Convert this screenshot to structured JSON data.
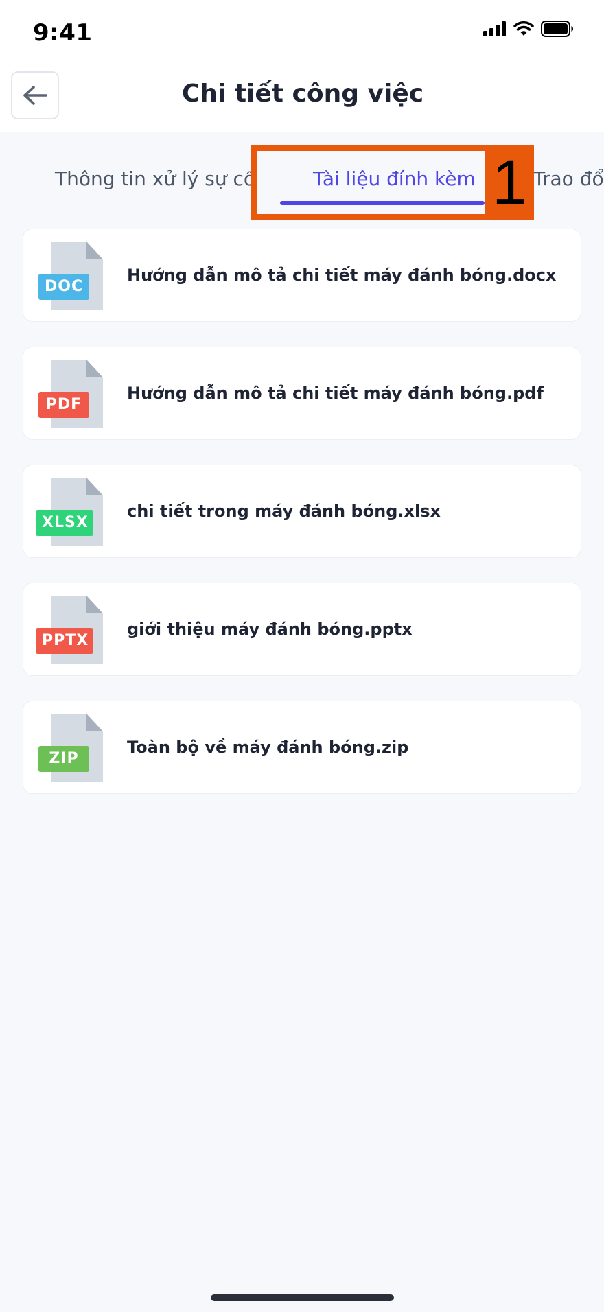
{
  "status_bar": {
    "time": "9:41",
    "icons": [
      "signal-icon",
      "wifi-icon",
      "battery-icon"
    ]
  },
  "header": {
    "title": "Chi tiết công việc",
    "back_icon": "arrow-left-icon"
  },
  "tabs": {
    "items": [
      {
        "label": "Thông tin xử lý sự cố"
      },
      {
        "label": "Tài liệu đính kèm"
      },
      {
        "label": "Trao đổi"
      }
    ],
    "active_index": 1,
    "active_color": "#4F46E5"
  },
  "annotation": {
    "number": "1",
    "color": "#E8590C"
  },
  "files": [
    {
      "type": "DOC",
      "name": "Hướng dẫn mô tả chi tiết máy đánh bóng.docx",
      "badge_color": "#4DB6E8"
    },
    {
      "type": "PDF",
      "name": "Hướng dẫn mô tả chi tiết máy đánh bóng.pdf",
      "badge_color": "#F0584A"
    },
    {
      "type": "XLSX",
      "name": "chi tiết trong máy đánh bóng.xlsx",
      "badge_color": "#2ED37A"
    },
    {
      "type": "PPTX",
      "name": "giới thiệu máy đánh bóng.pptx",
      "badge_color": "#F0584A"
    },
    {
      "type": "ZIP",
      "name": "Toàn bộ về máy đánh bóng.zip",
      "badge_color": "#6CC055"
    }
  ]
}
